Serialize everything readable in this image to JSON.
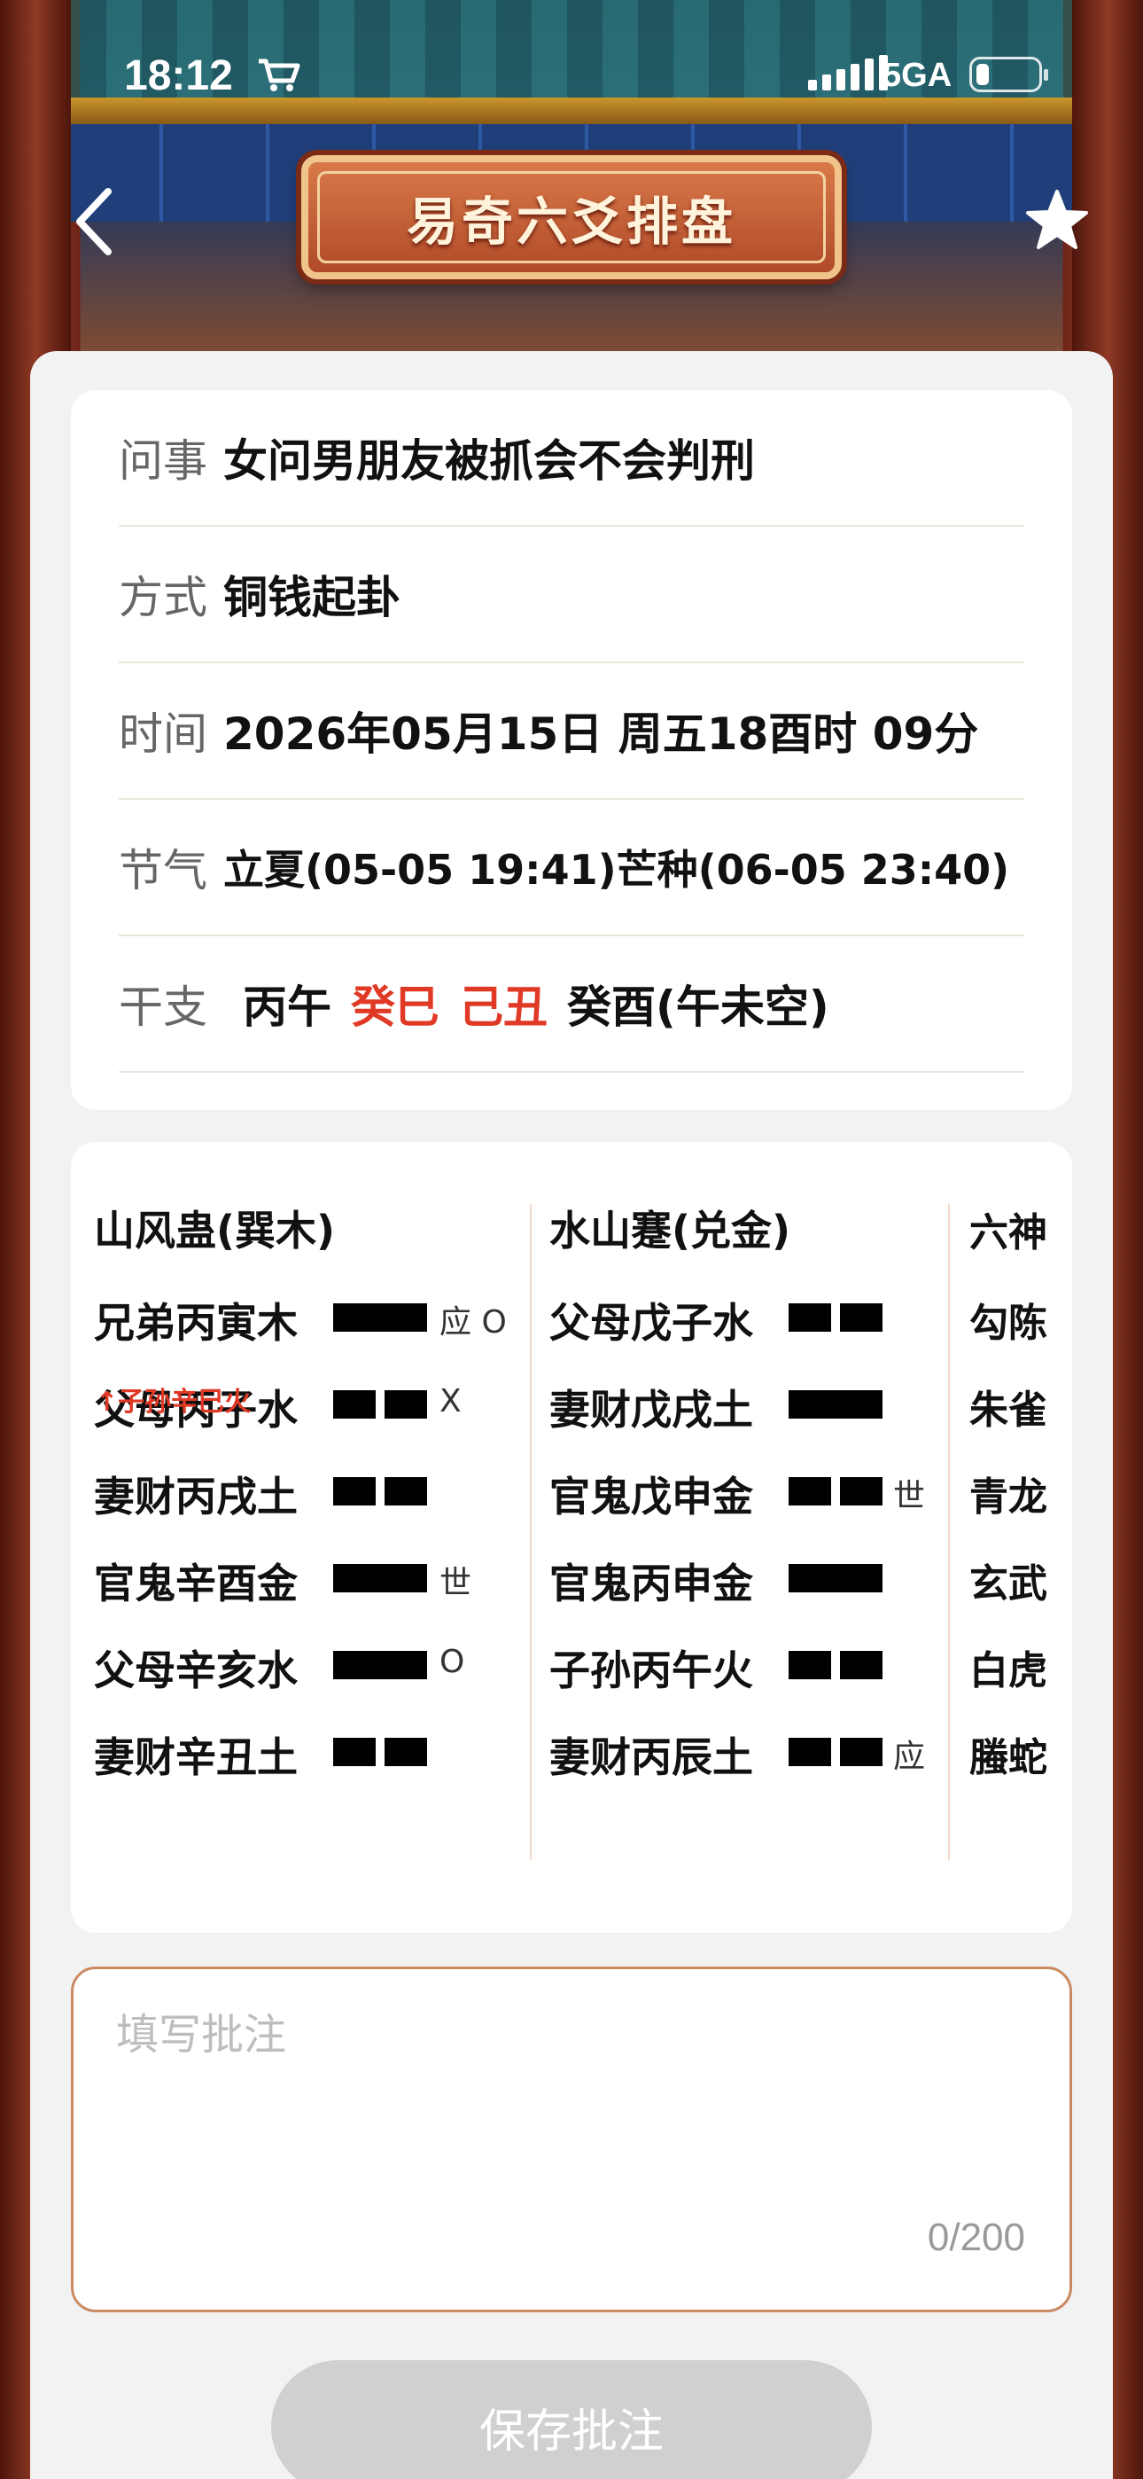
{
  "status_bar": {
    "time": "18:12",
    "network": "5GA"
  },
  "nav": {
    "title": "易奇六爻排盘"
  },
  "info": {
    "rows": [
      {
        "label": "问事",
        "value": "女问男朋友被抓会不会判刑"
      },
      {
        "label": "方式",
        "value": "铜钱起卦"
      },
      {
        "label": "时间",
        "value": "2026年05月15日 周五18酉时 09分"
      },
      {
        "label": "节气",
        "value": "立夏(05-05 19:41)芒种(06-05 23:40)"
      }
    ],
    "ganzhi": {
      "label": "干支",
      "year": "丙午",
      "month": "癸巳",
      "day": "己丑",
      "hour": "癸酉(午未空)"
    }
  },
  "hexagram": {
    "main": {
      "name": "山风蛊(巽木)",
      "lines": [
        {
          "label": "兄弟丙寅木",
          "type": "yang",
          "mark": "应 O"
        },
        {
          "label": "父母丙子水",
          "type": "yin",
          "mark": "X",
          "fu": "↑子孙辛巳火"
        },
        {
          "label": "妻财丙戌土",
          "type": "yin",
          "mark": ""
        },
        {
          "label": "官鬼辛酉金",
          "type": "yang",
          "mark": "世"
        },
        {
          "label": "父母辛亥水",
          "type": "yang",
          "mark": "O"
        },
        {
          "label": "妻财辛丑土",
          "type": "yin",
          "mark": ""
        }
      ]
    },
    "changed": {
      "name": "水山蹇(兑金)",
      "lines": [
        {
          "label": "父母戊子水",
          "type": "yin",
          "mark": ""
        },
        {
          "label": "妻财戊戌土",
          "type": "yang",
          "mark": ""
        },
        {
          "label": "官鬼戊申金",
          "type": "yin",
          "mark": "世"
        },
        {
          "label": "官鬼丙申金",
          "type": "yang",
          "mark": ""
        },
        {
          "label": "子孙丙午火",
          "type": "yin",
          "mark": ""
        },
        {
          "label": "妻财丙辰土",
          "type": "yin",
          "mark": "应"
        }
      ]
    },
    "six_spirits": {
      "header": "六神",
      "items": [
        "勾陈",
        "朱雀",
        "青龙",
        "玄武",
        "白虎",
        "螣蛇"
      ]
    }
  },
  "notes": {
    "placeholder": "填写批注",
    "count": "0/200"
  },
  "save_button": "保存批注"
}
